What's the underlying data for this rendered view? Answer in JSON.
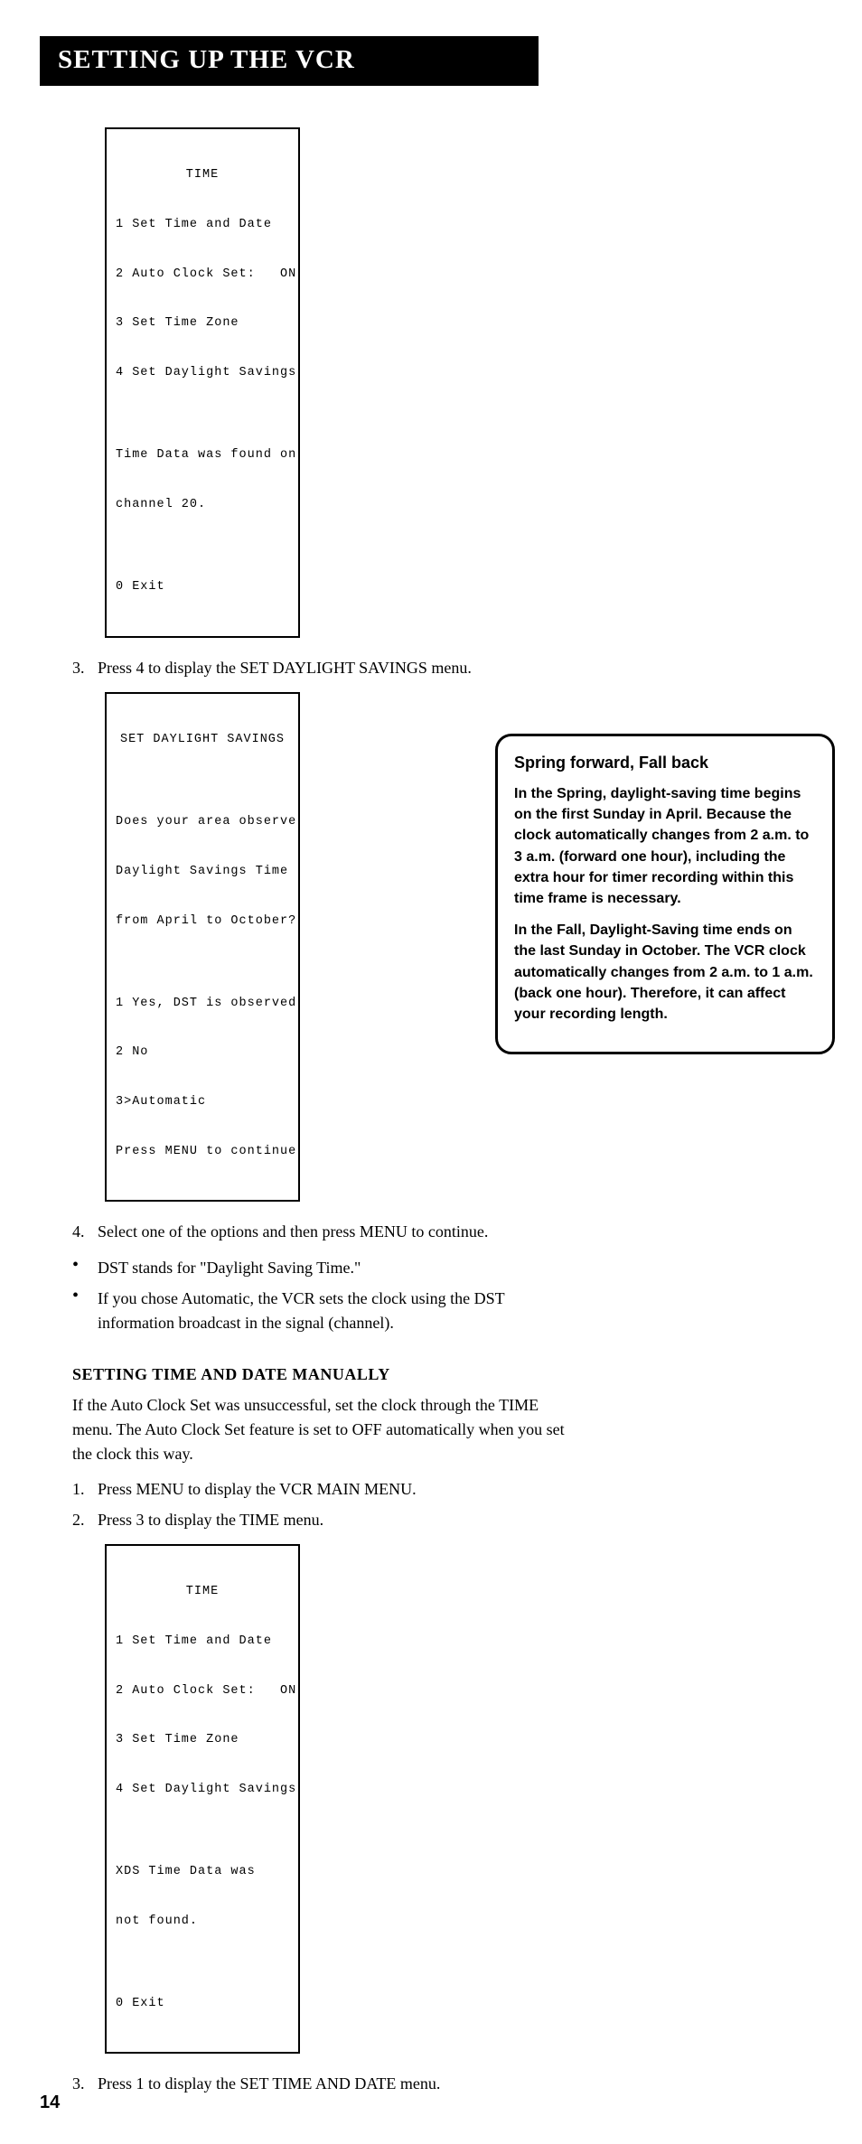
{
  "header": {
    "title": "Setting Up the VCR"
  },
  "menu1": {
    "title": "TIME",
    "lines": [
      "1 Set Time and Date",
      "2 Auto Clock Set:   ON",
      "3 Set Time Zone",
      "4 Set Daylight Savings",
      "",
      "Time Data was found on",
      "channel 20.",
      "",
      "0 Exit"
    ]
  },
  "step3": {
    "num": "3.",
    "text": "Press 4 to display the SET DAYLIGHT SAVINGS menu."
  },
  "menu2": {
    "title": "SET DAYLIGHT SAVINGS",
    "lines": [
      "",
      "Does your area observe",
      "Daylight Savings Time",
      "from April to October?",
      "",
      "1 Yes, DST is observed",
      "2 No",
      "3>Automatic",
      "Press MENU to continue"
    ]
  },
  "step4": {
    "num": "4.",
    "text": "Select one of the options and then press MENU to continue."
  },
  "bulletA": {
    "mark": "•",
    "text": "DST stands for \"Daylight Saving Time.\""
  },
  "bulletB": {
    "mark": "•",
    "text": "If you chose Automatic, the VCR sets the clock using the DST information broadcast in the signal (channel)."
  },
  "section2": {
    "heading": "Setting Time and Date Manually",
    "intro": "If the Auto Clock Set was unsuccessful, set the clock through the TIME menu. The Auto Clock Set feature is set to OFF automatically when you set the clock this way.",
    "s1": {
      "num": "1.",
      "text": "Press MENU to display the VCR MAIN MENU."
    },
    "s2": {
      "num": "2.",
      "text": "Press 3 to display the TIME menu."
    }
  },
  "menu3": {
    "title": "TIME",
    "lines": [
      "1 Set Time and Date",
      "2 Auto Clock Set:   ON",
      "3 Set Time Zone",
      "4 Set Daylight Savings",
      "",
      "XDS Time Data was",
      "not found.",
      "",
      "0 Exit"
    ]
  },
  "step3b": {
    "num": "3.",
    "text": "Press 1 to display the SET TIME AND DATE menu."
  },
  "sidebar": {
    "title": "Spring forward, Fall back",
    "p1": "In the Spring, daylight-saving time begins on the first Sunday in April. Because the clock automatically changes from 2 a.m. to 3 a.m. (forward one hour), including the extra hour for timer recording within this time frame is necessary.",
    "p2": "In the Fall, Daylight-Saving time ends on the last Sunday in October. The VCR clock automatically changes from 2 a.m. to 1 a.m. (back one hour). Therefore, it can affect your recording length."
  },
  "page_number": "14"
}
